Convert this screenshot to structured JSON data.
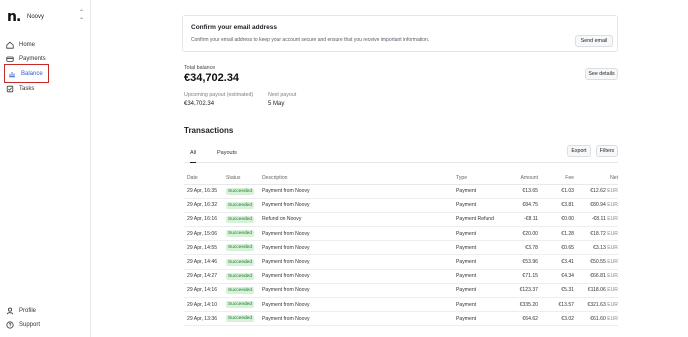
{
  "sidebar": {
    "brand_name": "Noovy",
    "logo_text": "n.",
    "items": [
      {
        "label": "Home"
      },
      {
        "label": "Payments"
      },
      {
        "label": "Balance"
      },
      {
        "label": "Tasks"
      }
    ],
    "footer_items": [
      {
        "label": "Profile"
      },
      {
        "label": "Support"
      }
    ]
  },
  "banner": {
    "title": "Confirm your email address",
    "description": "Confirm your email address to keep your account secure and ensure that you receive important information.",
    "button_label": "Send email"
  },
  "balance": {
    "total_label": "Total balance",
    "total_value": "€34,702.34",
    "see_details_label": "See details",
    "upcoming_label": "Upcoming payout (estimated)",
    "upcoming_value": "€34,702.34",
    "next_label": "Next payout",
    "next_value": "5 May"
  },
  "transactions": {
    "title": "Transactions",
    "tabs": [
      "All",
      "Payouts"
    ],
    "export_label": "Export",
    "filters_label": "Filters",
    "headers": [
      "Date",
      "Status",
      "Description",
      "Type",
      "Amount",
      "Fee",
      "Net"
    ],
    "rows": [
      {
        "date": "29 Apr, 16:35",
        "status": "Succeeded",
        "description": "Payment from Noovy",
        "type": "Payment",
        "amount": "€13.65",
        "fee": "€1.03",
        "net": "€12.62",
        "currency": "EUR"
      },
      {
        "date": "29 Apr, 16:32",
        "status": "Succeeded",
        "description": "Payment from Noovy",
        "type": "Payment",
        "amount": "€84.75",
        "fee": "€3.81",
        "net": "€80.94",
        "currency": "EUR"
      },
      {
        "date": "29 Apr, 16:16",
        "status": "Succeeded",
        "description": "Refund on Noovy",
        "type": "Payment Refund",
        "amount": "-€8.11",
        "fee": "€0.00",
        "net": "-€8.11",
        "currency": "EUR"
      },
      {
        "date": "29 Apr, 15:06",
        "status": "Succeeded",
        "description": "Payment from Noovy",
        "type": "Payment",
        "amount": "€20.00",
        "fee": "€1.28",
        "net": "€18.72",
        "currency": "EUR"
      },
      {
        "date": "29 Apr, 14:55",
        "status": "Succeeded",
        "description": "Payment from Noovy",
        "type": "Payment",
        "amount": "€3.78",
        "fee": "€0.65",
        "net": "€3.13",
        "currency": "EUR"
      },
      {
        "date": "29 Apr, 14:46",
        "status": "Succeeded",
        "description": "Payment from Noovy",
        "type": "Payment",
        "amount": "€53.96",
        "fee": "€3.41",
        "net": "€50.55",
        "currency": "EUR"
      },
      {
        "date": "29 Apr, 14:27",
        "status": "Succeeded",
        "description": "Payment from Noovy",
        "type": "Payment",
        "amount": "€71.15",
        "fee": "€4.34",
        "net": "€66.81",
        "currency": "EUR"
      },
      {
        "date": "29 Apr, 14:16",
        "status": "Succeeded",
        "description": "Payment from Noovy",
        "type": "Payment",
        "amount": "€123.37",
        "fee": "€5.31",
        "net": "€118.06",
        "currency": "EUR"
      },
      {
        "date": "29 Apr, 14:10",
        "status": "Succeeded",
        "description": "Payment from Noovy",
        "type": "Payment",
        "amount": "€335.20",
        "fee": "€13.57",
        "net": "€321.63",
        "currency": "EUR"
      },
      {
        "date": "29 Apr, 13:36",
        "status": "Succeeded",
        "description": "Payment from Noovy",
        "type": "Payment",
        "amount": "€64.62",
        "fee": "€3.02",
        "net": "€61.60",
        "currency": "EUR"
      }
    ]
  },
  "colors": {
    "accent": "#2e5bd9",
    "highlight_border": "#c52a2a",
    "success_bg": "#d7f2d8",
    "success_text": "#1f7a2f"
  }
}
